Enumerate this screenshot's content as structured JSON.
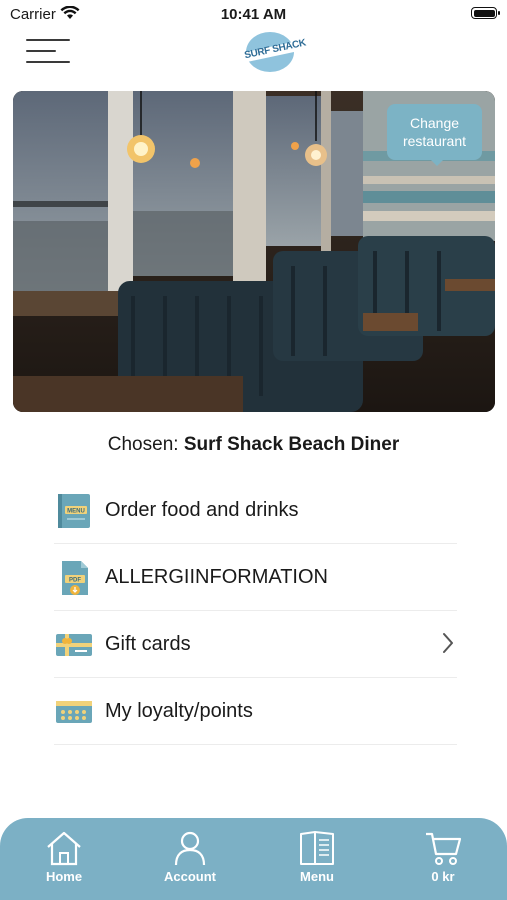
{
  "status_bar": {
    "carrier": "Carrier",
    "time": "10:41 AM"
  },
  "header": {
    "logo_text": "SURF SHACK",
    "brand_color": "#7cb0c5"
  },
  "hero": {
    "change_button_label": "Change restaurant"
  },
  "chosen": {
    "prefix": "Chosen: ",
    "restaurant_name": "Surf Shack Beach Diner"
  },
  "menu": {
    "items": [
      {
        "label": "Order food and drinks",
        "icon": "menu-book-icon"
      },
      {
        "label": "ALLERGIINFORMATION",
        "icon": "pdf-download-icon"
      },
      {
        "label": "Gift cards",
        "icon": "gift-card-icon",
        "has_chevron": true
      },
      {
        "label": "My loyalty/points",
        "icon": "loyalty-card-icon"
      }
    ]
  },
  "tabbar": {
    "tabs": [
      {
        "label": "Home",
        "icon": "home-icon"
      },
      {
        "label": "Account",
        "icon": "account-icon"
      },
      {
        "label": "Menu",
        "icon": "menu-icon"
      },
      {
        "label": "0 kr",
        "icon": "cart-icon"
      }
    ]
  }
}
